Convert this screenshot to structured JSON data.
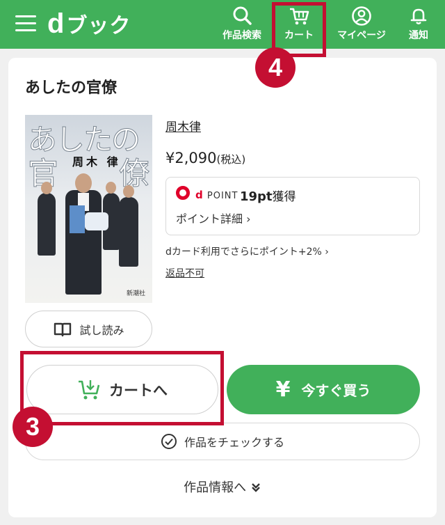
{
  "header": {
    "logo_text": "ブック",
    "nav": [
      {
        "label": "作品検索",
        "icon": "search-icon"
      },
      {
        "label": "カート",
        "icon": "cart-icon"
      },
      {
        "label": "マイページ",
        "icon": "user-icon"
      },
      {
        "label": "通知",
        "icon": "bell-icon"
      }
    ]
  },
  "book": {
    "title": "あしたの官僚",
    "cover_title_line1": "あしたの",
    "cover_title_line2_a": "官",
    "cover_title_line2_b": "僚",
    "cover_author": "周木 律",
    "cover_publisher": "新潮社",
    "author": "周木律",
    "price": "¥2,090",
    "tax_note": "(税込)",
    "dpoint_label": "POINT",
    "points": "19pt",
    "points_suffix": "獲得",
    "point_detail": "ポイント詳細 ›",
    "dcard_note": "dカード利用でさらにポイント+2% ›",
    "return_policy": "返品不可"
  },
  "buttons": {
    "trial": "試し読み",
    "cart": "カートへ",
    "buy": "今すぐ買う",
    "check": "作品をチェックする",
    "info": "作品情報へ"
  },
  "annotations": {
    "cart_step": "3",
    "header_cart_step": "4"
  },
  "colors": {
    "brand_green": "#41b05a",
    "highlight_red": "#c40f32",
    "dpoint_red": "#e0002a"
  }
}
